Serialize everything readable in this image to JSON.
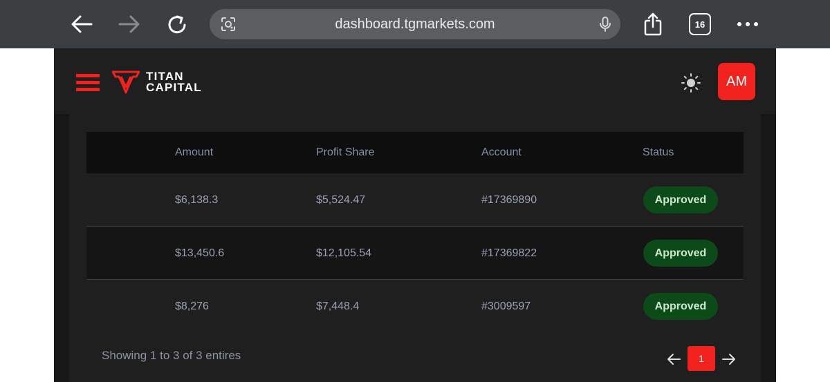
{
  "browser": {
    "url": "dashboard.tgmarkets.com",
    "tab_count": "16",
    "icons": [
      "back-arrow-icon",
      "forward-arrow-icon",
      "reload-icon",
      "camera-search-icon",
      "microphone-icon",
      "share-icon",
      "tabs-icon",
      "more-icon"
    ]
  },
  "header": {
    "logo_line1": "TITAN",
    "logo_line2": "CAPITAL",
    "avatar_initials": "AM",
    "accent_color": "#f2221f"
  },
  "table": {
    "columns": [
      "Amount",
      "Profit Share",
      "Account",
      "Status"
    ],
    "rows": [
      {
        "amount": "$6,138.3",
        "profit_share": "$5,524.47",
        "account": "#17369890",
        "status": "Approved"
      },
      {
        "amount": "$13,450.6",
        "profit_share": "$12,105.54",
        "account": "#17369822",
        "status": "Approved"
      },
      {
        "amount": "$8,276",
        "profit_share": "$7,448.4",
        "account": "#3009597",
        "status": "Approved"
      }
    ],
    "status_color": "#0d4a1a"
  },
  "footer": {
    "summary": "Showing 1 to 3 of 3 entires",
    "current_page": "1"
  }
}
